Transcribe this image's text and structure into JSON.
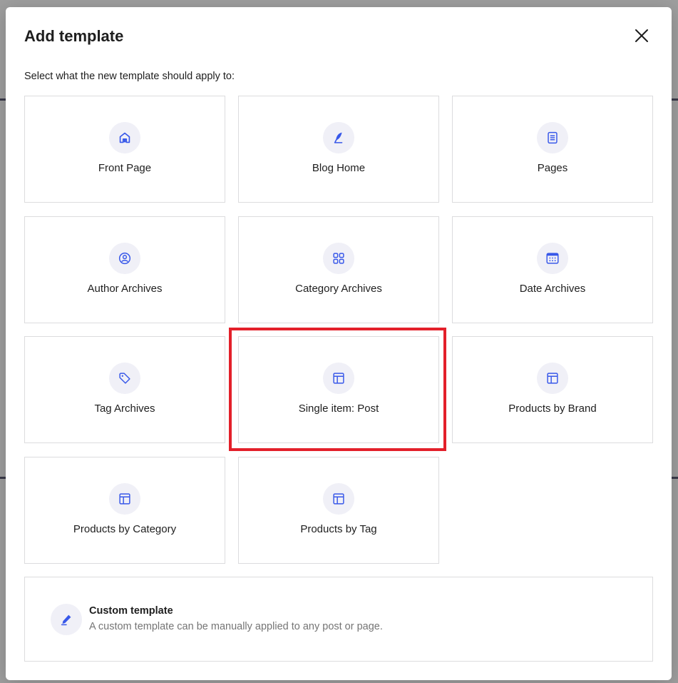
{
  "modal": {
    "title": "Add template",
    "subtitle": "Select what the new template should apply to:"
  },
  "accent_color": "#3858e9",
  "highlight_color": "#e3202a",
  "templates": [
    {
      "label": "Front Page",
      "icon": "home-icon"
    },
    {
      "label": "Blog Home",
      "icon": "feather-icon"
    },
    {
      "label": "Pages",
      "icon": "page-icon"
    },
    {
      "label": "Author Archives",
      "icon": "user-circle-icon"
    },
    {
      "label": "Category Archives",
      "icon": "grid-icon"
    },
    {
      "label": "Date Archives",
      "icon": "calendar-icon"
    },
    {
      "label": "Tag Archives",
      "icon": "tag-icon"
    },
    {
      "label": "Single item: Post",
      "icon": "layout-icon"
    },
    {
      "label": "Products by Brand",
      "icon": "layout-icon"
    },
    {
      "label": "Products by Category",
      "icon": "layout-icon"
    },
    {
      "label": "Products by Tag",
      "icon": "layout-icon"
    }
  ],
  "custom": {
    "title": "Custom template",
    "description": "A custom template can be manually applied to any post or page.",
    "icon": "pencil-icon"
  }
}
